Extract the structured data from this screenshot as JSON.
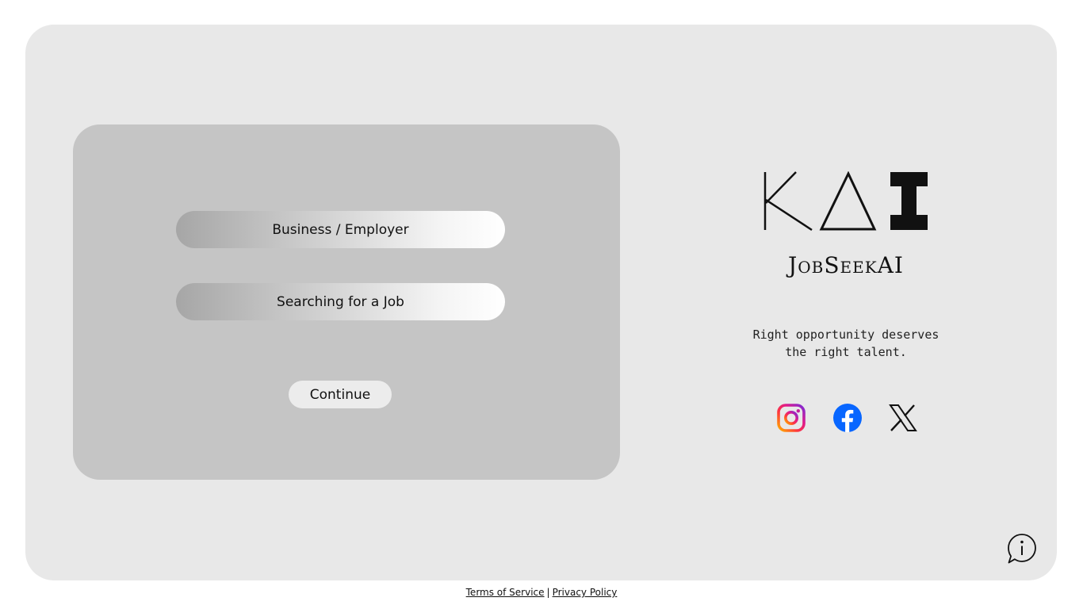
{
  "options": {
    "business_label": "Business / Employer",
    "job_label": "Searching for a Job",
    "continue_label": "Continue"
  },
  "brand": {
    "logo_text": "KΔI",
    "name": "JobSeekAI",
    "tagline_line1": "Right opportunity deserves",
    "tagline_line2": "the right talent."
  },
  "social": {
    "icons": [
      "instagram-icon",
      "facebook-icon",
      "x-icon"
    ]
  },
  "info": {
    "icon": "info-icon"
  },
  "footer": {
    "terms": "Terms of Service",
    "separator": "|",
    "privacy": "Privacy Policy"
  },
  "colors": {
    "outer_bg": "#e8e8e8",
    "panel_bg": "#c5c5c5",
    "facebook": "#0866ff"
  }
}
